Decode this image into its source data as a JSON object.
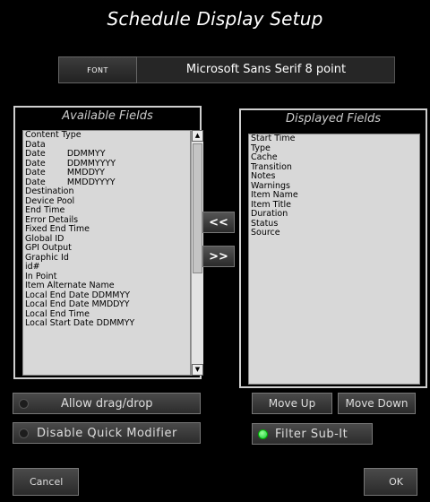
{
  "window": {
    "title": "Schedule Display Setup"
  },
  "font": {
    "button_label": "FONT",
    "value": "Microsoft Sans Serif 8 point"
  },
  "available": {
    "title": "Available Fields",
    "items": [
      "Content Type",
      "Data",
      "Date        DDMMYY",
      "Date        DDMMYYYY",
      "Date        MMDDYY",
      "Date        MMDDYYYY",
      "Destination",
      "Device Pool",
      "End Time",
      "Error Details",
      "Fixed End Time",
      "Global ID",
      "GPI Output",
      "Graphic Id",
      "id#",
      "In Point",
      "Item Alternate Name",
      "Local End Date DDMMYY",
      "Local End Date MMDDYY",
      "Local End Time",
      "Local Start Date DDMMYY"
    ]
  },
  "displayed": {
    "title": "Displayed Fields",
    "items": [
      "Start Time",
      "Type",
      "Cache",
      "Transition",
      "Notes",
      "Warnings",
      "Item Name",
      "Item Title",
      "Duration",
      "Status",
      "Source"
    ]
  },
  "arrows": {
    "left": "<<",
    "right": ">>"
  },
  "toggles": {
    "allow_drag": {
      "label": "Allow drag/drop",
      "on": false
    },
    "disable_quick": {
      "label": "Disable  Quick Modifier",
      "on": false
    },
    "filter_subit": {
      "label": "Filter  Sub-It",
      "on": true
    }
  },
  "buttons": {
    "move_up": "Move Up",
    "move_down": "Move Down",
    "cancel": "Cancel",
    "ok": "OK"
  },
  "scrollbar": {
    "up": "▲",
    "down": "▼"
  },
  "colors": {
    "led_on": "#22cc33",
    "background": "#000000",
    "list_bg": "#d8d8d8"
  }
}
